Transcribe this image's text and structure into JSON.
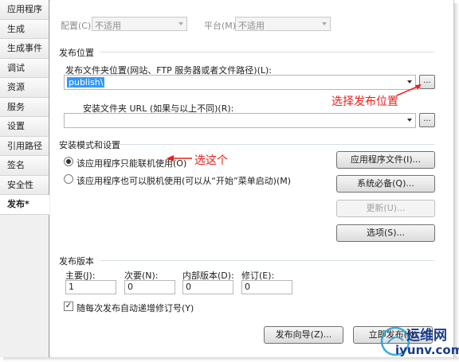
{
  "sidebar": {
    "items": [
      {
        "label": "应用程序"
      },
      {
        "label": "生成"
      },
      {
        "label": "生成事件"
      },
      {
        "label": "调试"
      },
      {
        "label": "资源"
      },
      {
        "label": "服务"
      },
      {
        "label": "设置"
      },
      {
        "label": "引用路径"
      },
      {
        "label": "签名"
      },
      {
        "label": "安全性"
      },
      {
        "label": "发布*"
      }
    ]
  },
  "top": {
    "config_label": "配置(C):",
    "config_value": "不适用",
    "platform_label": "平台(M):",
    "platform_value": "不适用"
  },
  "publish_location": {
    "header": "发布位置",
    "folder_label": "发布文件夹位置(网站、FTP 服务器或者文件路径)(L):",
    "folder_value": "publish\\",
    "browse_label": "...",
    "install_url_label": "安装文件夹 URL (如果与以上不同)(R):",
    "install_url_value": "",
    "browse2_label": "..."
  },
  "install_mode": {
    "header": "安装模式和设置",
    "online_only": "该应用程序只能联机使用(O)",
    "offline_too": "该应用程序也可以脱机使用(可以从“开始”菜单启动)(M)",
    "buttons": {
      "app_files": "应用程序文件(I)...",
      "prerequisites": "系统必备(Q)...",
      "updates": "更新(U)...",
      "options": "选项(S)..."
    }
  },
  "version": {
    "header": "发布版本",
    "major_label": "主要(J):",
    "major_value": "1",
    "minor_label": "次要(N):",
    "minor_value": "0",
    "build_label": "内部版本(D):",
    "build_value": "0",
    "revision_label": "修订(E):",
    "revision_value": "0",
    "auto_increment": "随每次发布自动递增修订号(Y)"
  },
  "footer": {
    "wizard_button": "发布向导(Z)...",
    "publish_now_button": "立即发布(N)"
  },
  "annotations": {
    "choose_location": "选择发布位置",
    "choose_this": "选这个"
  },
  "watermark": {
    "cn": "运维网",
    "url": "iyunv.com"
  },
  "colors": {
    "annotation": "#e8211c",
    "selection": "#3399ff"
  }
}
